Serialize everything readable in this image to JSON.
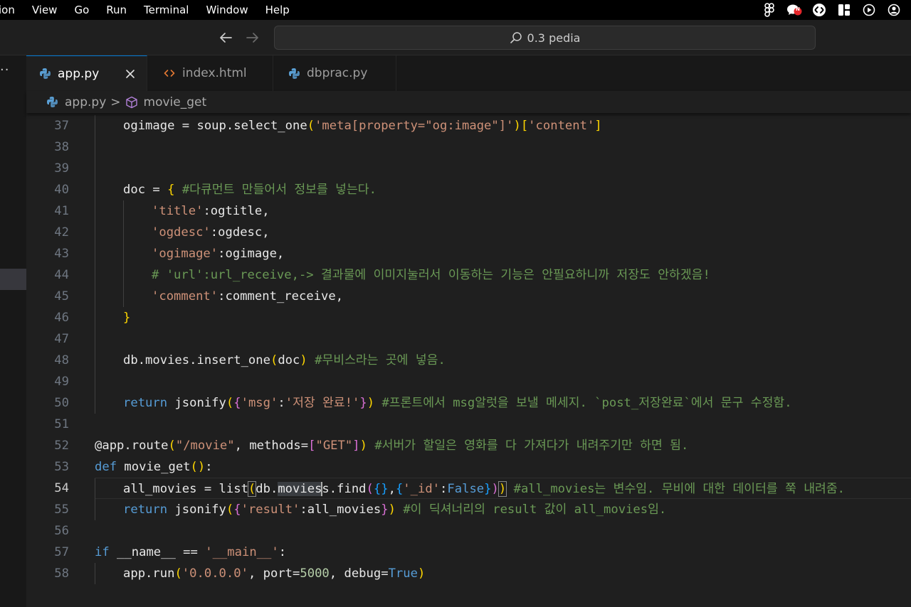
{
  "menubar": {
    "items": [
      "ion",
      "View",
      "Go",
      "Run",
      "Terminal",
      "Window",
      "Help"
    ],
    "status_icons": [
      "figma-icon",
      "chat-notification-icon",
      "shazam-icon",
      "layout-icon",
      "play-circle-icon",
      "user-account-icon"
    ],
    "notification_badge": "N"
  },
  "titlebar": {
    "command_center_text": "0.3 pedia"
  },
  "activity": {
    "more_glyph": "··"
  },
  "tabs": [
    {
      "label": "app.py",
      "icon": "python-icon",
      "active": true
    },
    {
      "label": "index.html",
      "icon": "html-brackets-icon",
      "active": false
    },
    {
      "label": "dbprac.py",
      "icon": "python-icon",
      "active": false
    }
  ],
  "breadcrumb": {
    "file": "app.py",
    "separator": ">",
    "symbol": "movie_get"
  },
  "editor": {
    "current_line": 54,
    "lines": [
      {
        "n": "37",
        "indent": 1,
        "tokens": [
          [
            "var",
            "ogimage = soup.select_one"
          ],
          [
            "br1",
            "("
          ],
          [
            "str",
            "'meta[property=\"og:image\"]'"
          ],
          [
            "br1",
            ")"
          ],
          [
            "br1",
            "["
          ],
          [
            "str",
            "'content'"
          ],
          [
            "br1",
            "]"
          ]
        ]
      },
      {
        "n": "38",
        "indent": 1,
        "tokens": []
      },
      {
        "n": "39",
        "indent": 1,
        "tokens": []
      },
      {
        "n": "40",
        "indent": 1,
        "tokens": [
          [
            "var",
            "doc = "
          ],
          [
            "br1",
            "{"
          ],
          [
            "var",
            " "
          ],
          [
            "com",
            "#다큐먼트 만들어서 정보를 넣는다."
          ]
        ]
      },
      {
        "n": "41",
        "indent": 2,
        "tokens": [
          [
            "str",
            "'title'"
          ],
          [
            "var",
            ":ogtitle,"
          ]
        ]
      },
      {
        "n": "42",
        "indent": 2,
        "tokens": [
          [
            "str",
            "'ogdesc'"
          ],
          [
            "var",
            ":ogdesc,"
          ]
        ]
      },
      {
        "n": "43",
        "indent": 2,
        "tokens": [
          [
            "str",
            "'ogimage'"
          ],
          [
            "var",
            ":ogimage,"
          ]
        ]
      },
      {
        "n": "44",
        "indent": 2,
        "tokens": [
          [
            "com",
            "# 'url':url_receive,-> 결과물에 이미지눌러서 이동하는 기능은 안필요하니까 저장도 안하겠음!"
          ]
        ]
      },
      {
        "n": "45",
        "indent": 2,
        "tokens": [
          [
            "str",
            "'comment'"
          ],
          [
            "var",
            ":comment_receive,"
          ]
        ]
      },
      {
        "n": "46",
        "indent": 1,
        "tokens": [
          [
            "br1",
            "}"
          ]
        ]
      },
      {
        "n": "47",
        "indent": 1,
        "tokens": []
      },
      {
        "n": "48",
        "indent": 1,
        "tokens": [
          [
            "var",
            "db.movies.insert_one"
          ],
          [
            "br1",
            "("
          ],
          [
            "var",
            "doc"
          ],
          [
            "br1",
            ")"
          ],
          [
            "var",
            " "
          ],
          [
            "com",
            "#무비스라는 곳에 넣음."
          ]
        ]
      },
      {
        "n": "49",
        "indent": 1,
        "tokens": []
      },
      {
        "n": "50",
        "indent": 1,
        "tokens": [
          [
            "kw",
            "return"
          ],
          [
            "var",
            " jsonify"
          ],
          [
            "br1",
            "("
          ],
          [
            "br2",
            "{"
          ],
          [
            "str",
            "'msg'"
          ],
          [
            "var",
            ":"
          ],
          [
            "str",
            "'저장 완료!'"
          ],
          [
            "br2",
            "}"
          ],
          [
            "br1",
            ")"
          ],
          [
            "var",
            " "
          ],
          [
            "com",
            "#프론트에서 msg알럿을 보낼 메세지. `post_저장완료`에서 문구 수정함."
          ]
        ]
      },
      {
        "n": "51",
        "indent": 0,
        "tokens": []
      },
      {
        "n": "52",
        "indent": 0,
        "tokens": [
          [
            "var",
            "@app.route"
          ],
          [
            "br1",
            "("
          ],
          [
            "str",
            "\"/movie\""
          ],
          [
            "var",
            ", methods="
          ],
          [
            "br2",
            "["
          ],
          [
            "str",
            "\"GET\""
          ],
          [
            "br2",
            "]"
          ],
          [
            "br1",
            ")"
          ],
          [
            "var",
            " "
          ],
          [
            "com",
            "#서버가 할일은 영화를 다 가져다가 내려주기만 하면 됨."
          ]
        ]
      },
      {
        "n": "53",
        "indent": 0,
        "tokens": [
          [
            "kw",
            "def"
          ],
          [
            "var",
            " movie_get"
          ],
          [
            "br1",
            "()"
          ],
          [
            "var",
            ":"
          ]
        ]
      },
      {
        "n": "54",
        "indent": 1,
        "tokens": [
          [
            "var",
            "all_movies = list"
          ],
          [
            "br1m",
            "("
          ],
          [
            "var",
            "db."
          ],
          [
            "sel",
            "movies"
          ],
          [
            "cursor",
            ""
          ],
          [
            "var",
            "s.find"
          ],
          [
            "br2",
            "("
          ],
          [
            "br3",
            "{}"
          ],
          [
            "var",
            ","
          ],
          [
            "br3",
            "{"
          ],
          [
            "str",
            "'_id'"
          ],
          [
            "var",
            ":"
          ],
          [
            "kw",
            "False"
          ],
          [
            "br3",
            "}"
          ],
          [
            "br2",
            ")"
          ],
          [
            "br1m",
            ")"
          ],
          [
            "var",
            " "
          ],
          [
            "com",
            "#all_movies는 변수임. 무비에 대한 데이터를 쭉 내려줌."
          ]
        ]
      },
      {
        "n": "55",
        "indent": 1,
        "tokens": [
          [
            "kw",
            "return"
          ],
          [
            "var",
            " jsonify"
          ],
          [
            "br1",
            "("
          ],
          [
            "br2",
            "{"
          ],
          [
            "str",
            "'result'"
          ],
          [
            "var",
            ":all_movies"
          ],
          [
            "br2",
            "}"
          ],
          [
            "br1",
            ")"
          ],
          [
            "var",
            " "
          ],
          [
            "com",
            "#이 딕셔너리의 result 값이 all_movies임."
          ]
        ]
      },
      {
        "n": "56",
        "indent": 0,
        "tokens": []
      },
      {
        "n": "57",
        "indent": 0,
        "tokens": [
          [
            "kw",
            "if"
          ],
          [
            "var",
            " __name__ == "
          ],
          [
            "str",
            "'__main__'"
          ],
          [
            "var",
            ":"
          ]
        ]
      },
      {
        "n": "58",
        "indent": 1,
        "tokens": [
          [
            "var",
            "app.run"
          ],
          [
            "br1",
            "("
          ],
          [
            "str",
            "'0.0.0.0'"
          ],
          [
            "var",
            ", port="
          ],
          [
            "num",
            "5000"
          ],
          [
            "var",
            ", debug="
          ],
          [
            "kw",
            "True"
          ],
          [
            "br1",
            ")"
          ]
        ]
      }
    ]
  }
}
